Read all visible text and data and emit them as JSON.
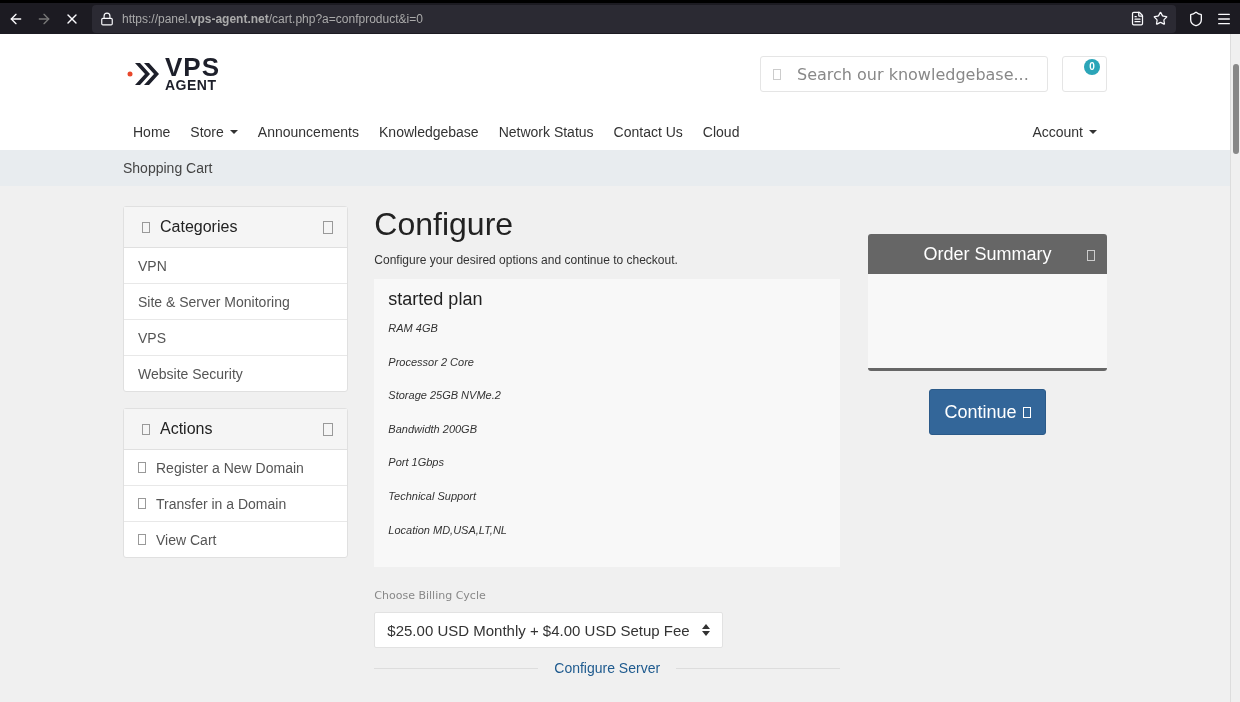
{
  "browser": {
    "url": "https://panel.**vps-agent.net**/cart.php?a=confproduct&i=0"
  },
  "logo": {
    "line_1": "VPS",
    "line_2": "AGENT"
  },
  "search": {
    "placeholder": "Search our knowledgebase..."
  },
  "cart": {
    "count": "0"
  },
  "nav": [
    {
      "label": "Home",
      "dropdown": false
    },
    {
      "label": "Store",
      "dropdown": true
    },
    {
      "label": "Announcements",
      "dropdown": false
    },
    {
      "label": "Knowledgebase",
      "dropdown": false
    },
    {
      "label": "Network Status",
      "dropdown": false
    },
    {
      "label": "Contact Us",
      "dropdown": false
    },
    {
      "label": "Cloud",
      "dropdown": false
    }
  ],
  "account": {
    "label": "Account"
  },
  "breadcrumb": "Shopping Cart",
  "sidebar": [
    {
      "title": "Categories",
      "items": [
        {
          "label": "VPN",
          "icon": false
        },
        {
          "label": "Site & Server Monitoring",
          "icon": false
        },
        {
          "label": "VPS",
          "icon": false
        },
        {
          "label": "Website Security",
          "icon": false
        }
      ]
    },
    {
      "title": "Actions",
      "items": [
        {
          "label": "Register a New Domain",
          "icon": true
        },
        {
          "label": "Transfer in a Domain",
          "icon": true
        },
        {
          "label": "View Cart",
          "icon": true
        }
      ]
    }
  ],
  "page": {
    "title": "Configure",
    "subtitle": "Configure your desired options and continue to checkout."
  },
  "product": {
    "name": "started plan",
    "features": [
      "RAM 4GB",
      "Processor 2 Core",
      "Storage 25GB NVMe.2",
      "Bandwidth 200GB",
      "Port 1Gbps",
      "Technical Support",
      "Location MD,USA,LT,NL"
    ]
  },
  "billing": {
    "label": "Choose Billing Cycle",
    "value": "$25.00 USD Monthly + $4.00 USD Setup Fee"
  },
  "section_heading": "Configure Server",
  "summary": {
    "title": "Order Summary"
  },
  "continue_button": "Continue"
}
